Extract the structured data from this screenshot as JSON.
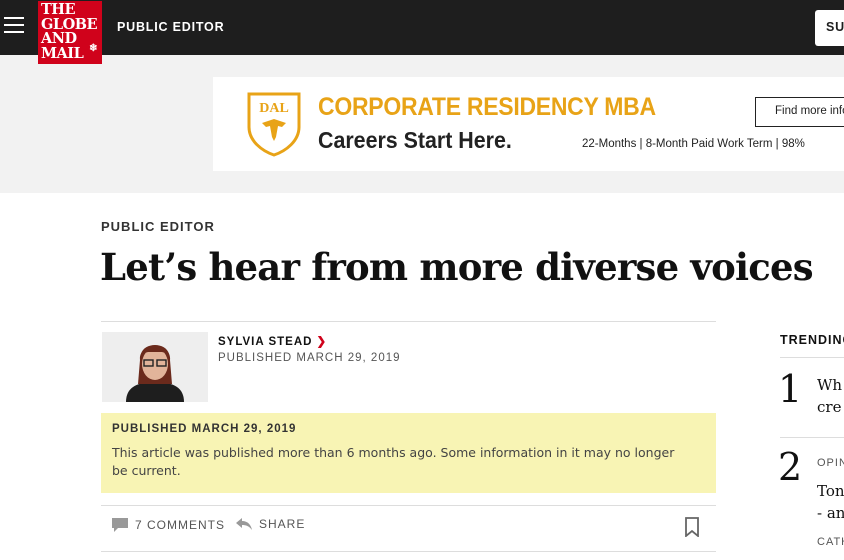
{
  "header": {
    "logo_lines": [
      "THE",
      "GLOBE",
      "AND",
      "MAIL"
    ],
    "logo_leaf_icon": "maple-leaf-icon",
    "section": "PUBLIC EDITOR",
    "subscribe": "SU",
    "colors": {
      "bar": "#1e1e1e",
      "logo": "#d0021b"
    }
  },
  "ad": {
    "shield_text": "DAL",
    "headline": "CORPORATE RESIDENCY MBA",
    "sub": "Careers Start Here.",
    "details": "22-Months  |  8-Month Paid Work Term  |  98%",
    "cta": "Find more info",
    "colors": {
      "accent": "#e8a317"
    }
  },
  "article": {
    "kicker": "PUBLIC EDITOR",
    "headline": "Let’s hear from more diverse voices",
    "author": "SYLVIA STEAD",
    "published": "PUBLISHED MARCH 29, 2019"
  },
  "notice": {
    "title": "PUBLISHED MARCH 29, 2019",
    "text": "This article was published more than 6 months ago. Some information in it may no longer be current."
  },
  "actions": {
    "comments": "7 COMMENTS",
    "share": "SHARE"
  },
  "trending": {
    "title": "TRENDING",
    "items": [
      {
        "num": "1",
        "lines": [
          "Wh",
          "cre"
        ]
      },
      {
        "num": "2",
        "category": "OPIN",
        "lines": [
          "Ton",
          "- an"
        ]
      }
    ],
    "next_category": "CATH"
  }
}
